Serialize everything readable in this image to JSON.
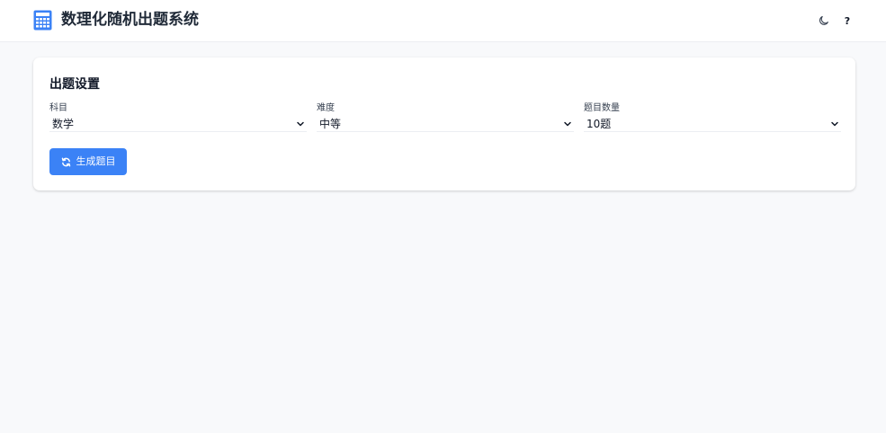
{
  "header": {
    "title": "数理化随机出题系统",
    "brand_icon": "calculator-icon",
    "theme_icon": "moon-icon",
    "help_label": "?"
  },
  "settings": {
    "title": "出题设置",
    "fields": [
      {
        "label": "科目",
        "value": "数学"
      },
      {
        "label": "难度",
        "value": "中等"
      },
      {
        "label": "题目数量",
        "value": "10题"
      }
    ],
    "generate_button": {
      "label": "生成题目",
      "icon": "refresh-icon"
    }
  },
  "colors": {
    "accent": "#3b82f6",
    "background": "#f8f9fb",
    "card": "#ffffff"
  }
}
